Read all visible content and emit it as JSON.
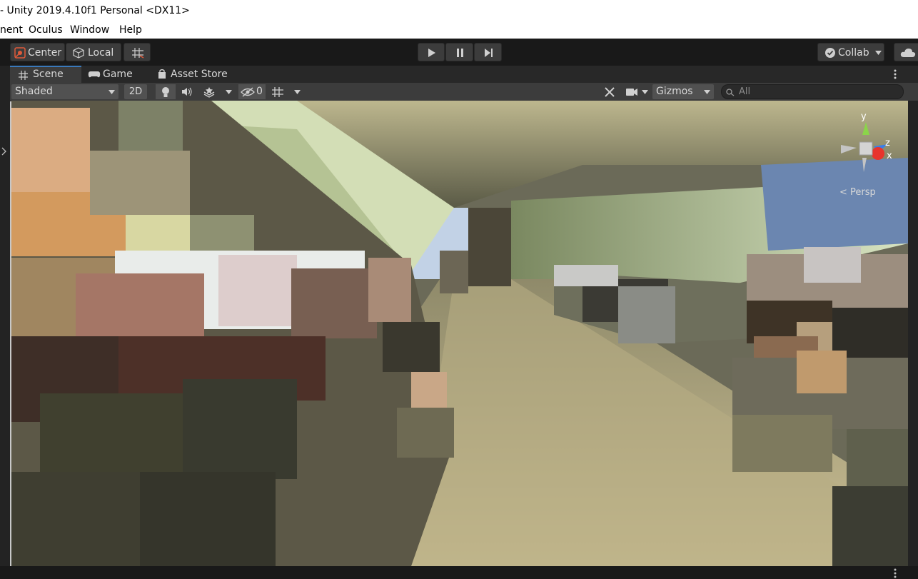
{
  "window": {
    "title": "- Unity 2019.4.10f1 Personal <DX11>"
  },
  "menu": {
    "items": [
      "nent",
      "Oculus",
      "Window",
      "Help"
    ]
  },
  "toolbar": {
    "center_label": "Center",
    "local_label": "Local",
    "collab_label": "Collab",
    "play_icon": "play-icon",
    "pause_icon": "pause-icon",
    "step_icon": "step-icon"
  },
  "tabs": [
    {
      "label": "Scene",
      "icon": "grid-icon",
      "active": true
    },
    {
      "label": "Game",
      "icon": "gamepad-icon",
      "active": false
    },
    {
      "label": "Asset Store",
      "icon": "bag-icon",
      "active": false
    }
  ],
  "scene_toolbar": {
    "shading_mode": "Shaded",
    "mode_2d": "2D",
    "hidden_count": "0",
    "gizmos_label": "Gizmos",
    "search_placeholder": "All"
  },
  "gizmo": {
    "y_label": "y",
    "z_label": "z",
    "x_label": "x",
    "projection": "< Persp"
  },
  "colors": {
    "accent": "#3a79bb",
    "toolbar_bg": "#191919",
    "panel_bg": "#3c3c3c",
    "axis_x": "#e8342c",
    "axis_y": "#8bd44a",
    "axis_z": "#3a7ee8"
  }
}
